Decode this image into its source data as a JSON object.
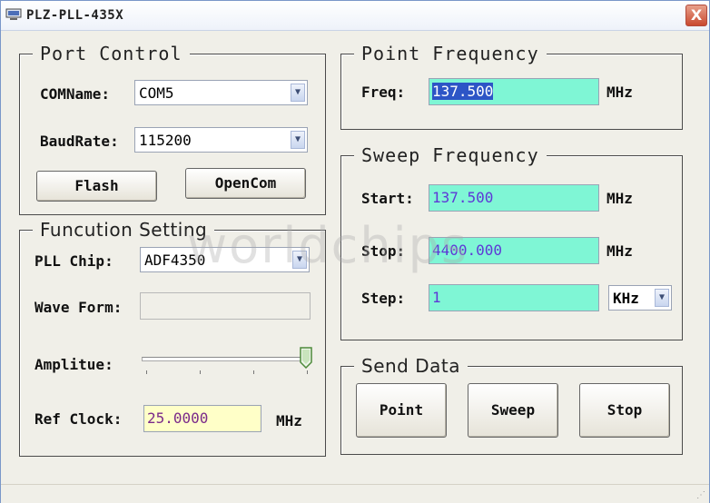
{
  "window": {
    "title": "PLZ-PLL-435X",
    "close_symbol": "X"
  },
  "port_control": {
    "title": "Port Control",
    "com_label": "COMName:",
    "com_value": "COM5",
    "baud_label": "BaudRate:",
    "baud_value": "115200",
    "flash_button": "Flash",
    "opencom_button": "OpenCom"
  },
  "function_setting": {
    "title": "Funcution Setting",
    "pll_label": "PLL Chip:",
    "pll_value": "ADF4350",
    "wave_label": "Wave Form:",
    "wave_value": "",
    "amplitude_label": "Amplitue:",
    "amplitude_level": 1.0,
    "ref_label": "Ref Clock:",
    "ref_value": "25.0000",
    "ref_unit": "MHz"
  },
  "point_frequency": {
    "title": "Point Frequency",
    "freq_label": "Freq:",
    "freq_value": "137.500",
    "unit": "MHz"
  },
  "sweep_frequency": {
    "title": "Sweep Frequency",
    "start_label": "Start:",
    "start_value": "137.500",
    "start_unit": "MHz",
    "stop_label": "Stop:",
    "stop_value": "4400.000",
    "stop_unit": "MHz",
    "step_label": "Step:",
    "step_value": "1",
    "step_unit": "KHz"
  },
  "send_data": {
    "title": "Send Data",
    "point_button": "Point",
    "sweep_button": "Sweep",
    "stop_button": "Stop"
  },
  "watermark": "worldchips",
  "colors": {
    "edit_bg": "#7ff6d5",
    "edit_text": "#5e38d6",
    "ref_bg": "#ffffc8",
    "ref_text": "#7a2a8a",
    "selection": "#2d55c6"
  }
}
